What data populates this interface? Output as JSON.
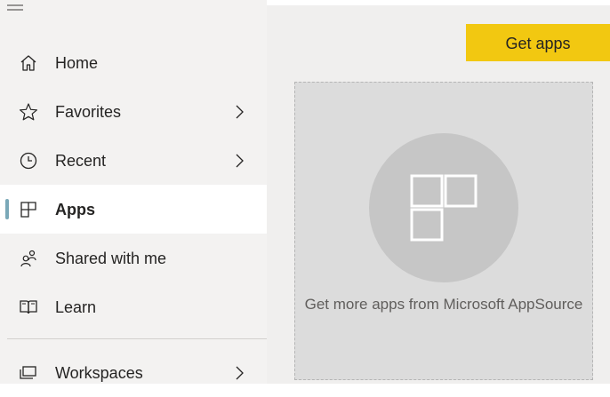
{
  "nav": {
    "items": [
      {
        "label": "Home",
        "icon": "home-icon"
      },
      {
        "label": "Favorites",
        "icon": "star-icon"
      },
      {
        "label": "Recent",
        "icon": "clock-icon"
      },
      {
        "label": "Apps",
        "icon": "apps-icon"
      },
      {
        "label": "Shared with me",
        "icon": "shared-icon"
      },
      {
        "label": "Learn",
        "icon": "book-icon"
      },
      {
        "label": "Workspaces",
        "icon": "workspaces-icon"
      }
    ],
    "active": "Apps"
  },
  "main": {
    "get_apps_label": "Get apps",
    "empty_message": "Get more apps from Microsoft AppSource"
  },
  "colors": {
    "accent": "#f2c811",
    "active_indicator": "#7aa8b8",
    "sidebar_bg": "#f3f2f1",
    "main_bg": "#f0efee"
  }
}
